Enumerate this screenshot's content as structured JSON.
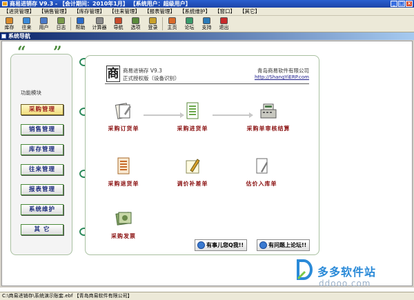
{
  "window": {
    "title": "商易进销存 V9.3 - 【会计期间：2010年1月】 【系统用户：超级用户】"
  },
  "menu": [
    "【进货管理】",
    "【销售管理】",
    "【库存管理】",
    "【往来管理】",
    "【报表管理】",
    "【系统维护】",
    "【窗口】",
    "【其它】"
  ],
  "toolbar": [
    {
      "label": "库存",
      "icon": "warehouse-icon",
      "color": "#d88a2a"
    },
    {
      "label": "往来",
      "icon": "exchange-icon",
      "color": "#3a8ad8"
    },
    {
      "label": "用户",
      "icon": "user-icon",
      "color": "#4a7ac8"
    },
    {
      "label": "日志",
      "icon": "log-icon",
      "color": "#7a9a4a"
    },
    {
      "label": "帮助",
      "icon": "help-icon",
      "color": "#2a6ac8"
    },
    {
      "label": "计算器",
      "icon": "calculator-icon",
      "color": "#8a8a8a"
    },
    {
      "label": "导航",
      "icon": "navigation-icon",
      "color": "#c84a2a"
    },
    {
      "label": "选项",
      "icon": "options-icon",
      "color": "#5a8a3a"
    },
    {
      "label": "登录",
      "icon": "login-icon",
      "color": "#c8a02a"
    },
    {
      "label": "主页",
      "icon": "home-icon",
      "color": "#d86a2a"
    },
    {
      "label": "论坛",
      "icon": "forum-icon",
      "color": "#3a9a6a"
    },
    {
      "label": "支持",
      "icon": "support-icon",
      "color": "#2a7ab8"
    },
    {
      "label": "退出",
      "icon": "exit-icon",
      "color": "#c82a2a"
    }
  ],
  "nav_window": {
    "title": "系统导航"
  },
  "left_panel": {
    "title": "功能模块",
    "modules": [
      {
        "label": "采购管理",
        "active": true
      },
      {
        "label": "销售管理",
        "active": false
      },
      {
        "label": "库存管理",
        "active": false
      },
      {
        "label": "往来管理",
        "active": false
      },
      {
        "label": "报表管理",
        "active": false
      },
      {
        "label": "系统维护",
        "active": false
      },
      {
        "label": "其 它",
        "active": false
      }
    ]
  },
  "product": {
    "logo_char": "商",
    "name": "商易进销存 V9.3",
    "edition": "正式授权版（设备识别）",
    "company": "青岛商易软件有限公司",
    "url": "http://ShangYiERP.com"
  },
  "functions": [
    {
      "label": "采购订货单",
      "icon": "purchase-order-icon"
    },
    {
      "label": "采购进货单",
      "icon": "purchase-receipt-icon"
    },
    {
      "label": "采购单审核结算",
      "icon": "cash-register-icon"
    },
    {
      "label": "采购退货单",
      "icon": "purchase-return-icon"
    },
    {
      "label": "调价补差单",
      "icon": "price-adjust-icon"
    },
    {
      "label": "估价入库单",
      "icon": "valuation-stock-in-icon"
    },
    {
      "label": "采购发票",
      "icon": "purchase-invoice-icon"
    }
  ],
  "help_buttons": {
    "qq": "有事儿您Q我!!",
    "forum": "有问题上论坛!!"
  },
  "watermark": {
    "title": "多多软件站",
    "url": "ddooo.com"
  },
  "statusbar": {
    "text": "C:\\商易进销存\\系统演示账套.ebf 【青岛商易软件有限公司】"
  }
}
